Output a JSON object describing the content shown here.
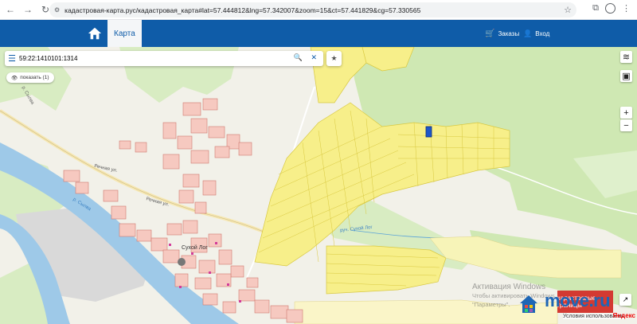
{
  "browser": {
    "url": "кадастровая-карта.рус/кадастровая_карта#lat=57.444812&lng=57.342007&zoom=15&ct=57.441829&cg=57.330565"
  },
  "header": {
    "tab_map": "Карта",
    "orders": "Заказы",
    "login": "Вход"
  },
  "search": {
    "value": "59:22:1410101:1314",
    "show_button": "показать (1)"
  },
  "map": {
    "labels": {
      "river_ul": "Речная ул.",
      "river_ul2": "Речная ул.",
      "suye": "Сухой Лог",
      "stream": "руч. Сухой Лог",
      "r_sylva": "р. Сылва",
      "r_sylva2": "р. Сылва"
    }
  },
  "overlays": {
    "activation_title": "Активация Windows",
    "activation_sub1": "Чтобы активировать Windows, перейдите в раздел",
    "activation_sub2": "\"Параметры\".",
    "red_button": "кадастровые границы",
    "move_logo": "move.ru",
    "terms": "Условия использования",
    "yandex": "Яндекс"
  },
  "colors": {
    "brand_blue": "#0f5ca8",
    "forest": "#c8e6a8",
    "river": "#9ec9e8",
    "parcel_yellow": "#f7ef8a",
    "parcel_red": "#f6c9c0"
  }
}
